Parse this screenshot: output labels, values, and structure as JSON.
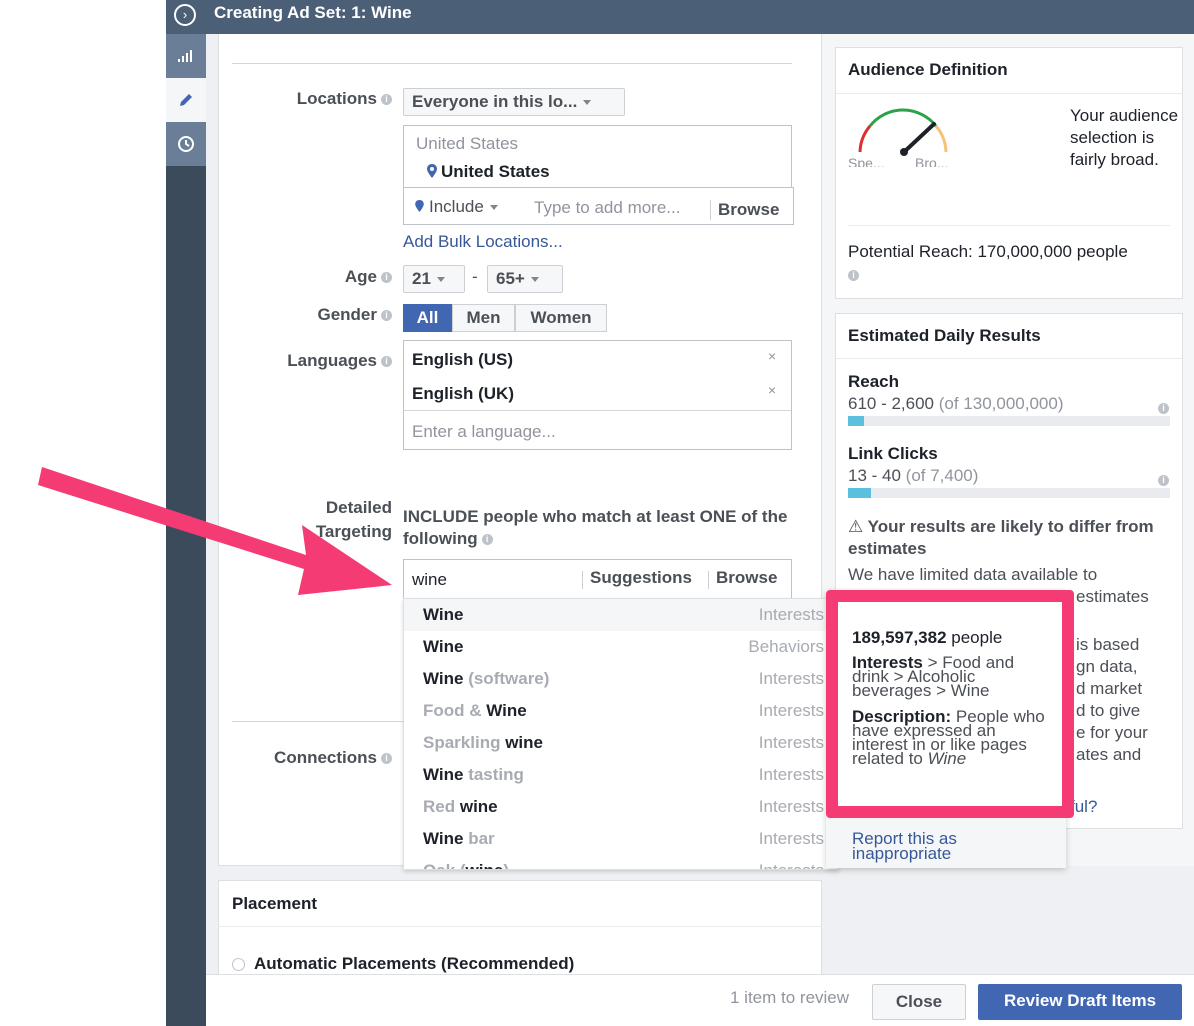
{
  "topbar": {
    "title": "Creating Ad Set: 1: Wine"
  },
  "form": {
    "locations_label": "Locations",
    "locations_select": "Everyone in this lo...",
    "location_group": "United States",
    "location_item": "United States",
    "include_label": "Include",
    "location_placeholder": "Type to add more...",
    "browse_label": "Browse",
    "bulk_link": "Add Bulk Locations...",
    "age_label": "Age",
    "age_min": "21",
    "age_max": "65+",
    "gender_label": "Gender",
    "gender_options": [
      "All",
      "Men",
      "Women"
    ],
    "languages_label": "Languages",
    "languages": [
      "English (US)",
      "English (UK)"
    ],
    "language_placeholder": "Enter a language...",
    "detailed_label_1": "Detailed",
    "detailed_label_2": "Targeting",
    "include_text": "INCLUDE people who match at least ONE of the following",
    "search_value": "wine",
    "suggestions_tab": "Suggestions",
    "browse_tab": "Browse",
    "connections_label": "Connections"
  },
  "suggestions": [
    {
      "pre": "",
      "bold": "Wine",
      "post": "",
      "cat": "Interests"
    },
    {
      "pre": "",
      "bold": "Wine",
      "post": "",
      "cat": "Behaviors"
    },
    {
      "pre": "",
      "bold": "Wine",
      "post": " (software)",
      "cat": "Interests"
    },
    {
      "pre": "Food & ",
      "bold": "Wine",
      "post": "",
      "cat": "Interests"
    },
    {
      "pre": "Sparkling ",
      "bold": "wine",
      "post": "",
      "cat": "Interests"
    },
    {
      "pre": "",
      "bold": "Wine",
      "post": " tasting",
      "cat": "Interests"
    },
    {
      "pre": "Red ",
      "bold": "wine",
      "post": "",
      "cat": "Interests"
    },
    {
      "pre": "",
      "bold": "Wine",
      "post": " bar",
      "cat": "Interests"
    },
    {
      "pre": "Oak (",
      "bold": "wine",
      "post": ")",
      "cat": "Interests"
    }
  ],
  "tooltip": {
    "count": "189,597,382",
    "count_unit": " people",
    "interests_label": "Interests",
    "interests_path": " > Food and drink > Alcoholic beverages > Wine",
    "description_label": "Description:",
    "description_text": " People who have expressed an interest in or like pages related to ",
    "description_em": "Wine",
    "report_link": "Report this as inappropriate"
  },
  "audience": {
    "title": "Audience Definition",
    "gauge_left": "Spe...",
    "gauge_right": "Bro...",
    "summary": "Your audience selection is fairly broad.",
    "reach_text": "Potential Reach: 170,000,000 people"
  },
  "estimates": {
    "title": "Estimated Daily Results",
    "reach_label": "Reach",
    "reach_range": "610 - 2,600",
    "reach_total": " (of 130,000,000)",
    "reach_fraction": 0.05,
    "clicks_label": "Link Clicks",
    "clicks_range": "13 - 40",
    "clicks_total": " (of 7,400)",
    "clicks_fraction": 0.07,
    "warning": "Your results are likely to differ from estimates",
    "note_1": "We have limited data available to",
    "note_2": "estimates",
    "note_3": "is based",
    "note_4": "gn data,",
    "note_5": "d market",
    "note_6": "d to give",
    "note_7": "e for your",
    "note_8": "ates and",
    "note_9": "ful?"
  },
  "placement": {
    "title": "Placement",
    "option": "Automatic Placements (Recommended)"
  },
  "footer": {
    "review_count": "1 item to review",
    "close": "Close",
    "review_btn": "Review Draft Items"
  },
  "colors": {
    "accent": "#4267b2",
    "highlight": "#f53b73",
    "topbar": "#4b5f77"
  }
}
